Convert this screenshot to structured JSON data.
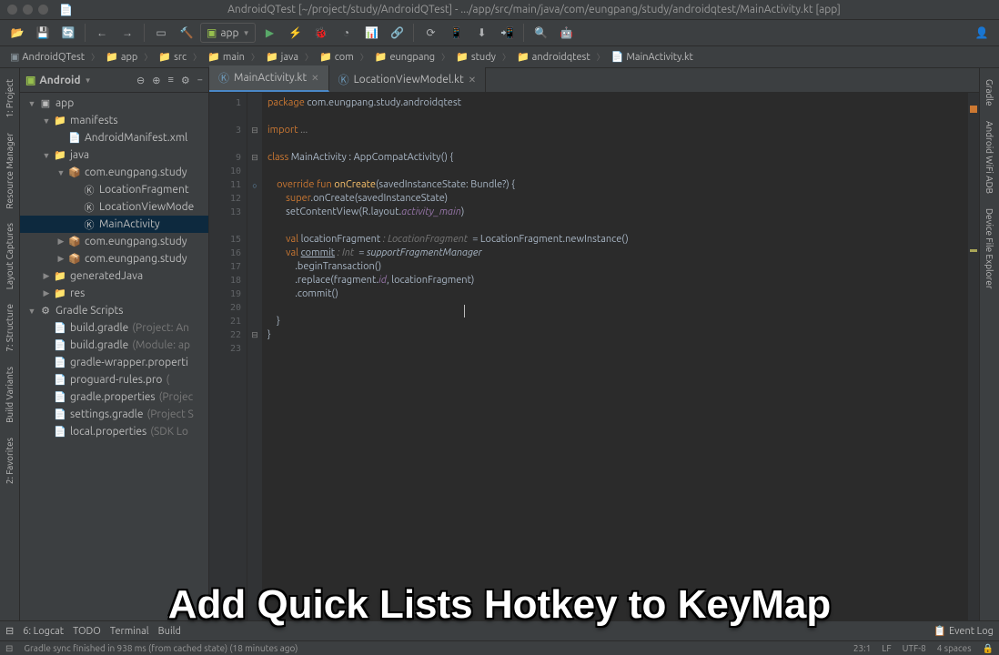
{
  "window": {
    "title": "AndroidQTest [~/project/study/AndroidQTest] - .../app/src/main/java/com/eungpang/study/androidqtest/MainActivity.kt [app]"
  },
  "run_config": {
    "label": "app"
  },
  "breadcrumbs": [
    "AndroidQTest",
    "app",
    "src",
    "main",
    "java",
    "com",
    "eungpang",
    "study",
    "androidqtest",
    "MainActivity.kt"
  ],
  "left_gutter_tabs": [
    "1: Project",
    "Resource Manager",
    "Layout Captures",
    "7: Structure",
    "Build Variants",
    "2: Favorites"
  ],
  "project": {
    "header_title": "Android",
    "tree": [
      {
        "depth": 0,
        "arrow": "▼",
        "icon": "app",
        "label": "app",
        "hint": ""
      },
      {
        "depth": 1,
        "arrow": "▼",
        "icon": "folder",
        "label": "manifests",
        "hint": ""
      },
      {
        "depth": 2,
        "arrow": "",
        "icon": "xml",
        "label": "AndroidManifest.xml",
        "hint": ""
      },
      {
        "depth": 1,
        "arrow": "▼",
        "icon": "folder",
        "label": "java",
        "hint": ""
      },
      {
        "depth": 2,
        "arrow": "▼",
        "icon": "pkg",
        "label": "com.eungpang.study",
        "hint": "",
        "cut": true
      },
      {
        "depth": 3,
        "arrow": "",
        "icon": "kt",
        "label": "LocationFragment",
        "hint": ""
      },
      {
        "depth": 3,
        "arrow": "",
        "icon": "kt",
        "label": "LocationViewMode",
        "hint": "",
        "cut": true
      },
      {
        "depth": 3,
        "arrow": "",
        "icon": "kt",
        "label": "MainActivity",
        "hint": "",
        "selected": true
      },
      {
        "depth": 2,
        "arrow": "▶",
        "icon": "pkg",
        "label": "com.eungpang.study",
        "hint": "",
        "cut": true
      },
      {
        "depth": 2,
        "arrow": "▶",
        "icon": "pkg",
        "label": "com.eungpang.study",
        "hint": "",
        "cut": true
      },
      {
        "depth": 1,
        "arrow": "▶",
        "icon": "folder",
        "label": "generatedJava",
        "hint": ""
      },
      {
        "depth": 1,
        "arrow": "▶",
        "icon": "folder",
        "label": "res",
        "hint": ""
      },
      {
        "depth": 0,
        "arrow": "▼",
        "icon": "gradle-root",
        "label": "Gradle Scripts",
        "hint": ""
      },
      {
        "depth": 1,
        "arrow": "",
        "icon": "gradle",
        "label": "build.gradle",
        "hint": "(Project: An"
      },
      {
        "depth": 1,
        "arrow": "",
        "icon": "gradle",
        "label": "build.gradle",
        "hint": "(Module: ap"
      },
      {
        "depth": 1,
        "arrow": "",
        "icon": "gradle",
        "label": "gradle-wrapper.properti",
        "hint": "",
        "cut": true
      },
      {
        "depth": 1,
        "arrow": "",
        "icon": "gradle",
        "label": "proguard-rules.pro",
        "hint": "(",
        "cut": true
      },
      {
        "depth": 1,
        "arrow": "",
        "icon": "gradle",
        "label": "gradle.properties",
        "hint": "(Projec"
      },
      {
        "depth": 1,
        "arrow": "",
        "icon": "gradle",
        "label": "settings.gradle",
        "hint": "(Project S"
      },
      {
        "depth": 1,
        "arrow": "",
        "icon": "gradle",
        "label": "local.properties",
        "hint": "(SDK Lo"
      }
    ]
  },
  "editor_tabs": [
    {
      "name": "MainActivity.kt",
      "active": true,
      "icon": "kt"
    },
    {
      "name": "LocationViewModel.kt",
      "active": false,
      "icon": "kt"
    }
  ],
  "code_lines": [
    [
      {
        "cls": "kw",
        "t": "package"
      },
      {
        "t": " com.eungpang.study.androidqtest"
      }
    ],
    [],
    [
      {
        "cls": "kw",
        "t": "import"
      },
      {
        "t": " "
      },
      {
        "cls": "cmt",
        "t": "..."
      }
    ],
    [],
    [
      {
        "cls": "kw",
        "t": "class"
      },
      {
        "t": " MainActivity : AppCompatActivity() {"
      }
    ],
    [],
    [
      {
        "t": "    "
      },
      {
        "cls": "kw",
        "t": "override"
      },
      {
        "t": " "
      },
      {
        "cls": "kw",
        "t": "fun"
      },
      {
        "t": " "
      },
      {
        "cls": "fn",
        "t": "onCreate"
      },
      {
        "t": "(savedInstanceState: Bundle?) {"
      }
    ],
    [
      {
        "t": "        "
      },
      {
        "cls": "kw",
        "t": "super"
      },
      {
        "t": ".onCreate(savedInstanceState)"
      }
    ],
    [
      {
        "t": "        setContentView(R.layout."
      },
      {
        "cls": "decl",
        "t": "activity_main"
      },
      {
        "t": ")"
      }
    ],
    [],
    [
      {
        "t": "        "
      },
      {
        "cls": "kw",
        "t": "val"
      },
      {
        "t": " locationFragment "
      },
      {
        "cls": "hint",
        "t": ": LocationFragment "
      },
      {
        "t": " = LocationFragment.newInstance()"
      }
    ],
    [
      {
        "t": "        "
      },
      {
        "cls": "kw",
        "t": "val"
      },
      {
        "t": " "
      },
      {
        "cls": "und",
        "t": "commit"
      },
      {
        "t": " "
      },
      {
        "cls": "hint",
        "t": ": Int "
      },
      {
        "t": " = "
      },
      {
        "cls": "it",
        "t": "supportFragmentManager"
      }
    ],
    [
      {
        "t": "            .beginTransaction()"
      }
    ],
    [
      {
        "t": "            .replace(fragment."
      },
      {
        "cls": "decl",
        "t": "id"
      },
      {
        "t": ", locationFragment)"
      }
    ],
    [
      {
        "t": "            .commit()"
      }
    ],
    [],
    [
      {
        "t": "    }"
      }
    ],
    [
      {
        "t": "}"
      }
    ],
    []
  ],
  "line_numbers": [
    "1",
    "",
    "3",
    "",
    "9",
    "10",
    "11",
    "12",
    "13",
    "",
    "15",
    "16",
    "17",
    "18",
    "19",
    "20",
    "21",
    "22",
    "23"
  ],
  "right_gutter_tabs": [
    "Gradle",
    "Android WiFi ADB",
    "Device File Explorer"
  ],
  "bottom_bar": {
    "items": [
      "6: Logcat",
      "TODO",
      "Terminal",
      "Build"
    ],
    "right": "Event Log"
  },
  "status_bar": {
    "left": "Gradle sync finished in 938 ms (from cached state) (18 minutes ago)",
    "right": [
      "23:1",
      "LF",
      "UTF-8",
      "4 spaces"
    ]
  },
  "caption": "Add Quick Lists Hotkey to KeyMap"
}
